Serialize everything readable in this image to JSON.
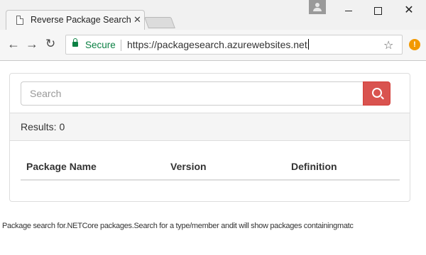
{
  "browser": {
    "tab_title": "Reverse Package Search",
    "tab_close_glyph": "✕",
    "secure_label": "Secure",
    "url": "https://packagesearch.azurewebsites.net",
    "back_glyph": "←",
    "forward_glyph": "→",
    "reload_glyph": "↻",
    "star_glyph": "☆",
    "extension_glyph": "!",
    "close_glyph": "✕",
    "icons": [
      "page-icon",
      "lock-icon",
      "star-icon",
      "profile-icon",
      "extension-icon"
    ],
    "colors": {
      "secure": "#0b8043",
      "extension": "#f29900"
    }
  },
  "search": {
    "placeholder": "Search",
    "value": "",
    "button_color": "#d9534f",
    "button_icon": "magnifier-icon"
  },
  "results": {
    "label": "Results: 0"
  },
  "table": {
    "headers": [
      "Package Name",
      "Version",
      "Definition"
    ],
    "rows": []
  },
  "footer": {
    "text": "Package search for.NETCore packages.Search for a type/member andit will show packages containingmatc"
  }
}
